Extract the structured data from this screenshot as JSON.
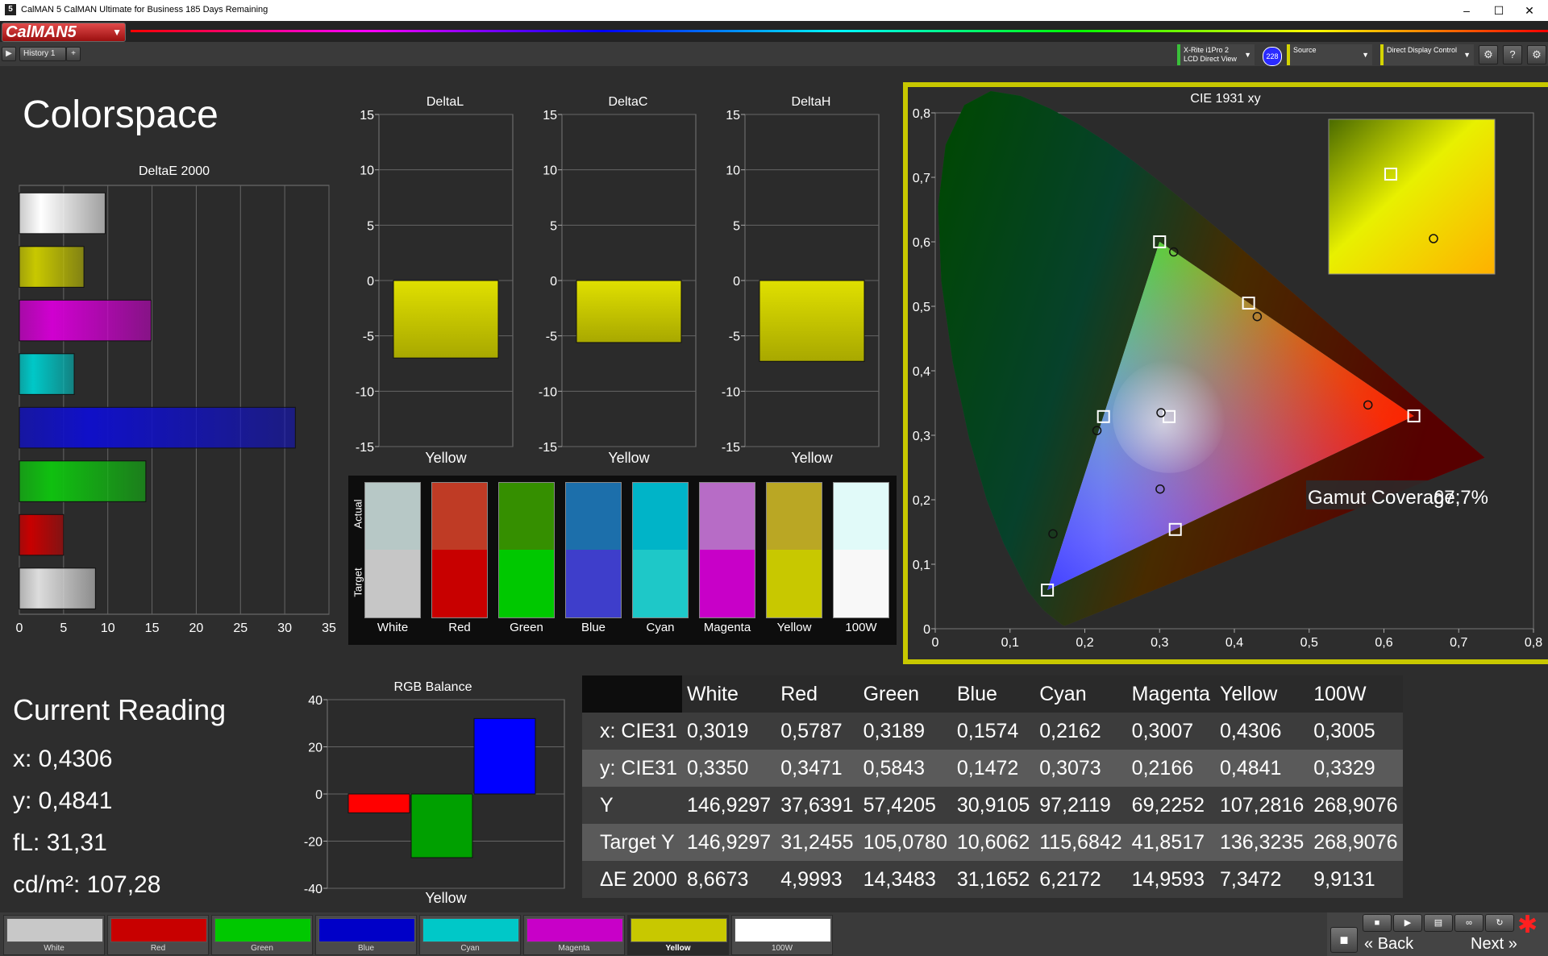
{
  "window": {
    "title": "CalMAN 5 CalMAN Ultimate for Business 185 Days Remaining",
    "icon": "5"
  },
  "brand": {
    "logo": "CalMAN5"
  },
  "tabs": [
    {
      "label": "History 1"
    }
  ],
  "toolbar": {
    "meter": {
      "line1": "X-Rite i1Pro 2",
      "line2": "LCD Direct View"
    },
    "meter_badge": "228",
    "source": "Source",
    "display": "Direct Display Control"
  },
  "page": {
    "title": "Colorspace"
  },
  "deltae_chart": {
    "title": "DeltaE 2000",
    "xticks": [
      "0",
      "5",
      "10",
      "15",
      "20",
      "25",
      "30",
      "35"
    ]
  },
  "delta_charts": [
    {
      "title": "DeltaL",
      "category": "Yellow",
      "value": -7.0
    },
    {
      "title": "DeltaC",
      "category": "Yellow",
      "value": -5.6
    },
    {
      "title": "DeltaH",
      "category": "Yellow",
      "value": -7.3
    }
  ],
  "delta_yticks": [
    "15",
    "10",
    "5",
    "0",
    "-5",
    "-10",
    "-15"
  ],
  "swatch_panel": {
    "actual_label": "Actual",
    "target_label": "Target",
    "items": [
      {
        "label": "White",
        "actual": "#b7c8c6",
        "target": "#c6c6c6"
      },
      {
        "label": "Red",
        "actual": "#bf3b25",
        "target": "#c80000"
      },
      {
        "label": "Green",
        "actual": "#358f00",
        "target": "#00c800"
      },
      {
        "label": "Blue",
        "actual": "#1c6fab",
        "target": "#3e3ecb"
      },
      {
        "label": "Cyan",
        "actual": "#00b4c8",
        "target": "#1ec8c8"
      },
      {
        "label": "Magenta",
        "actual": "#b76cc6",
        "target": "#c800c8"
      },
      {
        "label": "Yellow",
        "actual": "#baa724",
        "target": "#c8c800"
      },
      {
        "label": "100W",
        "actual": "#e1faf9",
        "target": "#f8f8f8"
      }
    ]
  },
  "cie_chart": {
    "title": "CIE 1931 xy",
    "xticks": [
      "0",
      "0,1",
      "0,2",
      "0,3",
      "0,4",
      "0,5",
      "0,6",
      "0,7",
      "0,8"
    ],
    "yticks": [
      "0",
      "0,1",
      "0,2",
      "0,3",
      "0,4",
      "0,5",
      "0,6",
      "0,7",
      "0,8"
    ],
    "gamut_label": "Gamut Coverage:",
    "gamut_value": "67,7%"
  },
  "current_reading": {
    "title": "Current Reading",
    "x": "x: 0,4306",
    "y": "y: 0,4841",
    "fl": "fL: 31,31",
    "cd": "cd/m²: 107,28"
  },
  "rgb_balance": {
    "title": "RGB Balance",
    "category": "Yellow",
    "yticks": [
      "40",
      "20",
      "0",
      "-20",
      "-40"
    ]
  },
  "table": {
    "headers": [
      "",
      "White",
      "Red",
      "Green",
      "Blue",
      "Cyan",
      "Magenta",
      "Yellow",
      "100W"
    ],
    "rows": [
      [
        "x: CIE31",
        "0,3019",
        "0,5787",
        "0,3189",
        "0,1574",
        "0,2162",
        "0,3007",
        "0,4306",
        "0,3005"
      ],
      [
        "y: CIE31",
        "0,3350",
        "0,3471",
        "0,5843",
        "0,1472",
        "0,3073",
        "0,2166",
        "0,4841",
        "0,3329"
      ],
      [
        "Y",
        "146,9297",
        "37,6391",
        "57,4205",
        "30,9105",
        "97,2119",
        "69,2252",
        "107,2816",
        "268,9076"
      ],
      [
        "Target Y",
        "146,9297",
        "31,2455",
        "105,0780",
        "10,6062",
        "115,6842",
        "41,8517",
        "136,3235",
        "268,9076"
      ],
      [
        "ΔE 2000",
        "8,6673",
        "4,9993",
        "14,3483",
        "31,1652",
        "6,2172",
        "14,9593",
        "7,3472",
        "9,9131"
      ]
    ]
  },
  "bottom_swatches": [
    {
      "label": "White",
      "color": "#c8c8c8"
    },
    {
      "label": "Red",
      "color": "#c80000"
    },
    {
      "label": "Green",
      "color": "#00c800"
    },
    {
      "label": "Blue",
      "color": "#0000c8"
    },
    {
      "label": "Cyan",
      "color": "#00c8c8"
    },
    {
      "label": "Magenta",
      "color": "#c800c8"
    },
    {
      "label": "Yellow",
      "color": "#c8c800"
    },
    {
      "label": "100W",
      "color": "#ffffff"
    }
  ],
  "selected_swatch": "Yellow",
  "nav": {
    "back": "Back",
    "next": "Next"
  },
  "chart_data": [
    {
      "type": "bar",
      "title": "DeltaE 2000",
      "orientation": "horizontal",
      "categories": [
        "White",
        "Yellow",
        "Magenta",
        "Cyan",
        "Blue",
        "Green",
        "Red",
        "100W"
      ],
      "values": [
        9.7,
        7.3,
        14.9,
        6.2,
        31.2,
        14.3,
        5.0,
        8.6
      ],
      "colors": [
        "#ffffff",
        "#c8c800",
        "#d000d0",
        "#00c8c8",
        "#1010c8",
        "#10c010",
        "#c80000",
        "#dcdcdc"
      ],
      "xlim": [
        0,
        35
      ],
      "grid": true
    },
    {
      "type": "bar",
      "title": "DeltaL",
      "categories": [
        "Yellow"
      ],
      "values": [
        -7.0
      ],
      "ylim": [
        -15,
        15
      ]
    },
    {
      "type": "bar",
      "title": "DeltaC",
      "categories": [
        "Yellow"
      ],
      "values": [
        -5.6
      ],
      "ylim": [
        -15,
        15
      ]
    },
    {
      "type": "bar",
      "title": "DeltaH",
      "categories": [
        "Yellow"
      ],
      "values": [
        -7.3
      ],
      "ylim": [
        -15,
        15
      ]
    },
    {
      "type": "bar",
      "title": "RGB Balance",
      "categories": [
        "Yellow"
      ],
      "series": [
        {
          "values": [
            -8
          ],
          "color": "#ff0000"
        },
        {
          "values": [
            -27
          ],
          "color": "#00a000"
        },
        {
          "values": [
            32
          ],
          "color": "#0000ff"
        }
      ],
      "ylim": [
        -40,
        40
      ]
    },
    {
      "type": "scatter",
      "title": "CIE 1931 xy",
      "xlim": [
        0,
        0.8
      ],
      "ylim": [
        0,
        0.8
      ],
      "targets": [
        {
          "x": 0.64,
          "y": 0.33
        },
        {
          "x": 0.3,
          "y": 0.6
        },
        {
          "x": 0.15,
          "y": 0.06
        },
        {
          "x": 0.225,
          "y": 0.329
        },
        {
          "x": 0.321,
          "y": 0.154
        },
        {
          "x": 0.419,
          "y": 0.505
        },
        {
          "x": 0.3127,
          "y": 0.329
        }
      ],
      "measured": [
        {
          "x": 0.5787,
          "y": 0.3471
        },
        {
          "x": 0.3189,
          "y": 0.5843
        },
        {
          "x": 0.1574,
          "y": 0.1472
        },
        {
          "x": 0.2162,
          "y": 0.3073
        },
        {
          "x": 0.3007,
          "y": 0.2166
        },
        {
          "x": 0.4306,
          "y": 0.4841
        },
        {
          "x": 0.3019,
          "y": 0.335
        }
      ],
      "inset": {
        "target": {
          "x": 0.419,
          "y": 0.505
        },
        "measured": {
          "x": 0.4306,
          "y": 0.4841
        }
      }
    }
  ]
}
